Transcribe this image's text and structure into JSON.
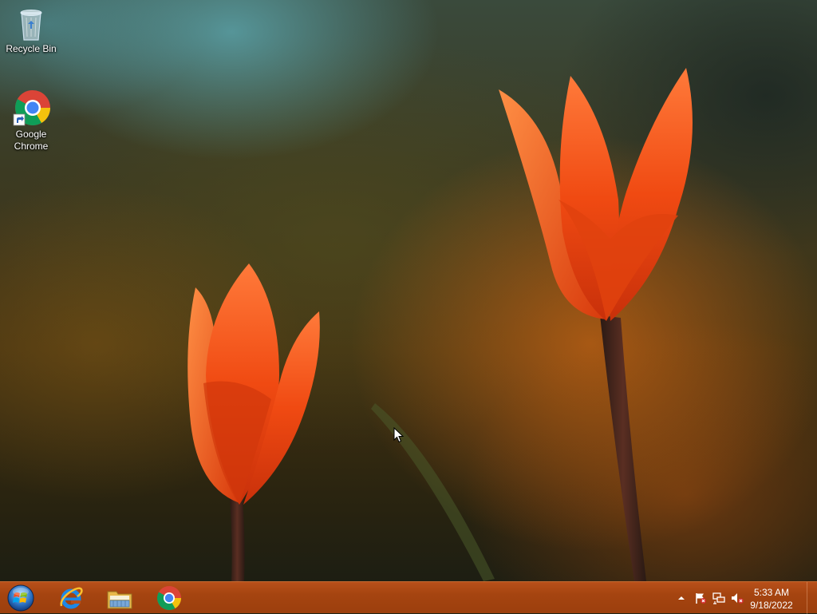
{
  "desktop": {
    "icons": [
      {
        "label": "Recycle Bin",
        "icon": "recycle-bin-icon"
      },
      {
        "label": "Google Chrome",
        "icon": "chrome-icon"
      }
    ],
    "wallpaper": "orange-tulips"
  },
  "taskbar": {
    "color": "#a54410",
    "start": {
      "icon": "windows-start-orb-icon"
    },
    "pinned": [
      {
        "icon": "internet-explorer-icon"
      },
      {
        "icon": "file-explorer-icon"
      },
      {
        "icon": "chrome-icon"
      }
    ],
    "tray": {
      "icons": [
        "show-hidden-icons-arrow",
        "action-center-flag-icon",
        "network-icon",
        "volume-muted-icon"
      ]
    },
    "clock": {
      "time": "5:33 AM",
      "date": "9/18/2022"
    }
  }
}
